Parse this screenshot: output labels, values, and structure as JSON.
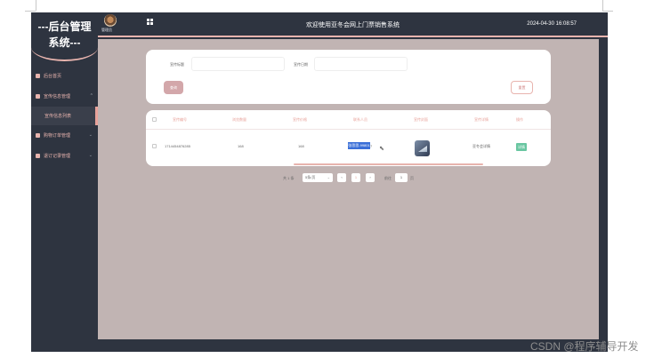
{
  "sidebar": {
    "title_line1": "---后台管理",
    "title_line2": "系统---",
    "items": [
      {
        "label": "后台首页"
      },
      {
        "label": "宣传信息管理"
      },
      {
        "label": "宣传信息列表"
      },
      {
        "label": "购物订单管理"
      },
      {
        "label": "退订记录管理"
      }
    ]
  },
  "header": {
    "user_name": "管理员",
    "title": "欢迎使用亚冬会网上门票销售系统",
    "datetime": "2024-04-30 16:08:57"
  },
  "search": {
    "field1_label": "宣传标题",
    "field1_placeholder": "",
    "field2_label": "宣传日期",
    "field2_placeholder": "",
    "search_button": "查询",
    "reset_button": "重置"
  },
  "table": {
    "columns": [
      "宣传编号",
      "浏览数量",
      "宣传价格",
      "联系人员",
      "宣传封面",
      "宣传详情",
      "操作"
    ],
    "rows": [
      {
        "id": "1714454876285",
        "views": "168",
        "price": "168",
        "contact_highlighted": "张思思-99801",
        "contact_tail": "7",
        "detail": "亚冬会详情",
        "action": "详情"
      }
    ]
  },
  "pagination": {
    "total": "共 1 条",
    "page_size": "5条/页",
    "prev": "‹",
    "current": "1",
    "next": "›",
    "goto_label": "前往",
    "goto_value": "1",
    "page_suffix": "页"
  },
  "watermark": "CSDN @程序辅导开发",
  "colors": {
    "sidebar_bg": "#2e3440",
    "accent": "#e8b4ae",
    "content_bg": "#c1b4b3",
    "detail_button": "#69c6a1",
    "selection": "#3a6fd8"
  }
}
